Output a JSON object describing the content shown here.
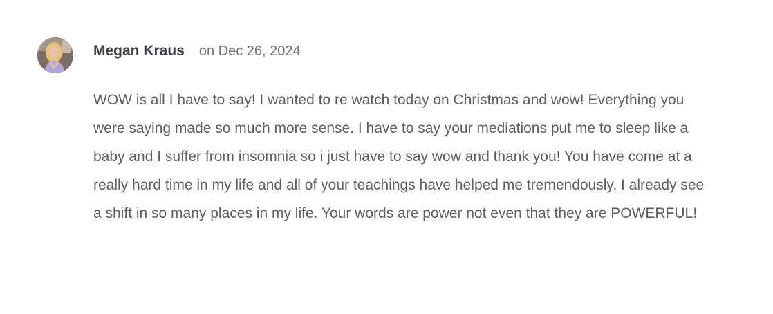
{
  "comment": {
    "author": "Megan Kraus",
    "date": "on Dec 26, 2024",
    "avatar_icon": "user-avatar-photo",
    "text": "WOW is all I have to say! I wanted to re watch today on Christmas and wow! Everything you were saying made so much more sense. I have to say your mediations put me to sleep like a baby and I suffer from insomnia so i just have to say wow and thank you! You have come at a really hard time in my life and all of your teachings have helped me tremendously. I already see a shift in so many places in my life. Your words are power not even that they are POWERFUL!"
  },
  "colors": {
    "author": "#3f4147",
    "date": "#70737a",
    "text": "#5b5e65",
    "background": "#ffffff"
  }
}
